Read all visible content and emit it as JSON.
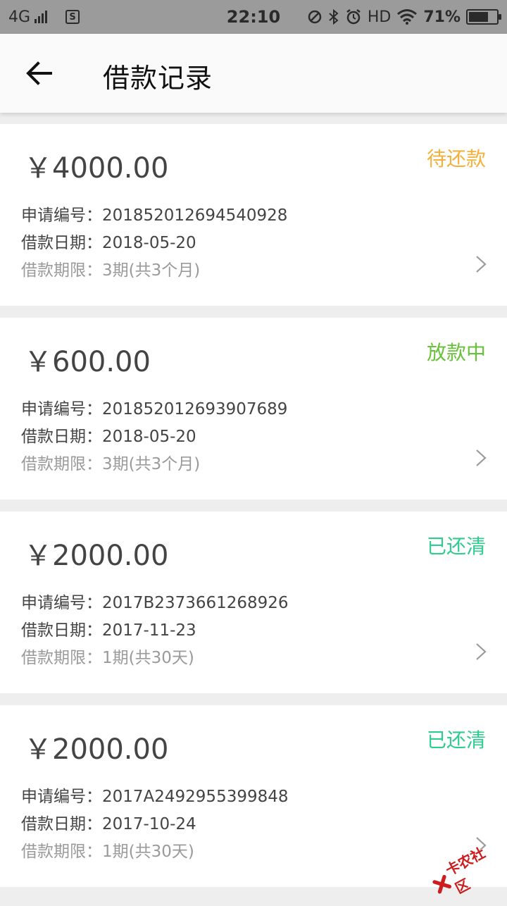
{
  "status_bar": {
    "network": "4G",
    "time": "22:10",
    "hd": "HD",
    "battery": "71%",
    "battery_level": 0.71,
    "sim_label": "S"
  },
  "header": {
    "title": "借款记录"
  },
  "labels": {
    "app_no": "申请编号：",
    "date": "借款日期：",
    "term": "借款期限："
  },
  "loans": [
    {
      "amount": "￥4000.00",
      "status": "待还款",
      "status_color": "#f5b03a",
      "app_no": "201852012694540928",
      "date": "2018-05-20",
      "term": "3期(共3个月)"
    },
    {
      "amount": "￥600.00",
      "status": "放款中",
      "status_color": "#67c23a",
      "app_no": "201852012693907689",
      "date": "2018-05-20",
      "term": "3期(共3个月)"
    },
    {
      "amount": "￥2000.00",
      "status": "已还清",
      "status_color": "#2ecc8e",
      "app_no": "2017B2373661268926",
      "date": "2017-11-23",
      "term": "1期(共30天)"
    },
    {
      "amount": "￥2000.00",
      "status": "已还清",
      "status_color": "#2ecc8e",
      "app_no": "2017A2492955399848",
      "date": "2017-10-24",
      "term": "1期(共30天)"
    }
  ],
  "watermark": {
    "text": "卡农社区"
  }
}
